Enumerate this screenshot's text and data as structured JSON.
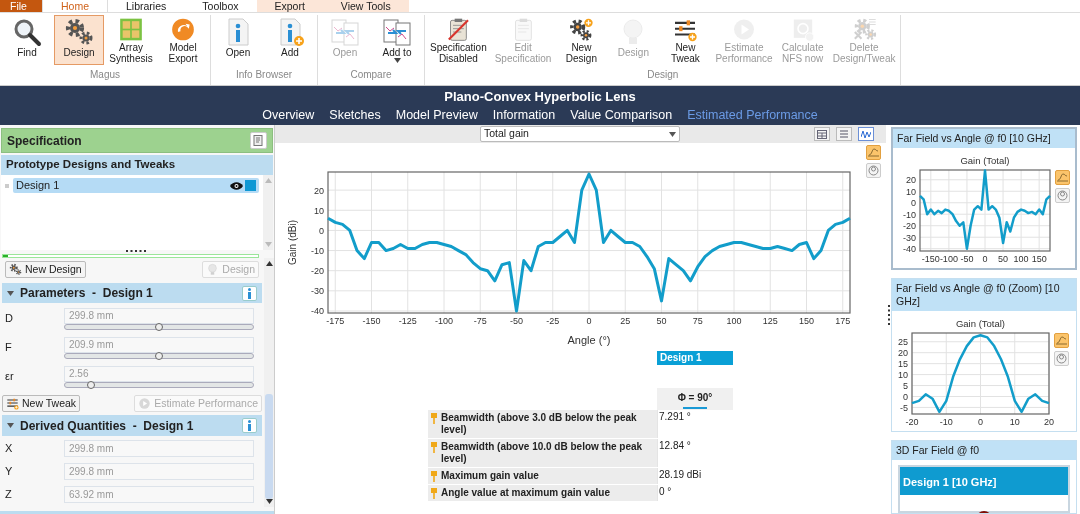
{
  "ribbon_tabs": [
    {
      "label": "File",
      "kind": "file",
      "selected": false
    },
    {
      "label": "Home",
      "kind": "tab",
      "selected": true
    },
    {
      "label": "Libraries",
      "kind": "tab",
      "selected": false
    },
    {
      "label": "Toolbox",
      "kind": "tab",
      "selected": false
    },
    {
      "label": "Export",
      "kind": "context",
      "selected": false
    },
    {
      "label": "View Tools",
      "kind": "context",
      "selected": false
    }
  ],
  "ribbon_groups": [
    {
      "label": "Magus",
      "buttons": [
        {
          "label": "Find",
          "kind": "search",
          "selected": false,
          "disabled": false
        },
        {
          "label": "Design",
          "kind": "gears",
          "selected": true,
          "disabled": false
        },
        {
          "label": "Array Synthesis",
          "kind": "grid",
          "selected": false,
          "disabled": false
        },
        {
          "label": "Model Export",
          "kind": "export",
          "selected": false,
          "disabled": false
        }
      ]
    },
    {
      "label": "Info Browser",
      "buttons": [
        {
          "label": "Open",
          "kind": "info",
          "selected": false,
          "disabled": false
        },
        {
          "label": "Add",
          "kind": "infoadd",
          "selected": false,
          "disabled": false
        }
      ]
    },
    {
      "label": "Compare",
      "buttons": [
        {
          "label": "Open",
          "kind": "compare",
          "selected": false,
          "disabled": true
        },
        {
          "label": "Add to",
          "kind": "compareadd",
          "selected": false,
          "disabled": false,
          "dropdown": true
        }
      ]
    },
    {
      "label": "Design",
      "buttons": [
        {
          "label": "Specification Disabled",
          "kind": "specoff",
          "selected": false,
          "disabled": false
        },
        {
          "label": "Edit Specification",
          "kind": "clipboard",
          "selected": false,
          "disabled": true
        },
        {
          "label": "New Design",
          "kind": "gearsadd",
          "selected": false,
          "disabled": false
        },
        {
          "label": "Design",
          "kind": "bulb",
          "selected": false,
          "disabled": true
        },
        {
          "label": "New Tweak",
          "kind": "tweak",
          "selected": false,
          "disabled": false
        },
        {
          "label": "Estimate Performance",
          "kind": "play",
          "selected": false,
          "disabled": true
        },
        {
          "label": "Calculate NFS now",
          "kind": "nfs",
          "selected": false,
          "disabled": true
        },
        {
          "label": "Delete Design/Tweak",
          "kind": "gearsx",
          "selected": false,
          "disabled": true
        }
      ]
    }
  ],
  "document": {
    "title": "Plano-Convex Hyperbolic Lens",
    "nav": [
      {
        "label": "Overview",
        "selected": false
      },
      {
        "label": "Sketches",
        "selected": false
      },
      {
        "label": "Model Preview",
        "selected": false
      },
      {
        "label": "Information",
        "selected": false
      },
      {
        "label": "Value Comparison",
        "selected": false
      },
      {
        "label": "Estimated Performance",
        "selected": true
      }
    ]
  },
  "left_panel": {
    "title": "Specification",
    "designs_header": "Prototype Designs and Tweaks",
    "designs": [
      {
        "label": "Design 1",
        "selected": true,
        "visible": true,
        "color": "#0e98d4"
      }
    ],
    "progress": {
      "level": 0.02
    },
    "top_buttons": [
      {
        "label": "New Design",
        "kind": "gears",
        "disabled": false
      },
      {
        "label": "Design",
        "kind": "bulb",
        "disabled": true
      }
    ],
    "parameters": {
      "title": "Parameters  -  Design 1",
      "rows": [
        {
          "name": "D",
          "value": "299.8 mm",
          "level": 0.5
        },
        {
          "name": "F",
          "value": "209.9 mm",
          "level": 0.5
        },
        {
          "name": "εr",
          "value": "2.56",
          "level": 0.14
        }
      ]
    },
    "bottom_buttons": [
      {
        "label": "New Tweak",
        "kind": "tweak",
        "disabled": false
      },
      {
        "label": "Estimate Performance",
        "kind": "play",
        "disabled": true
      }
    ],
    "derived": {
      "title": "Derived Quantities  -  Design 1",
      "rows": [
        {
          "name": "X",
          "value": "299.8 mm"
        },
        {
          "name": "Y",
          "value": "299.8 mm"
        },
        {
          "name": "Z",
          "value": "63.92 mm"
        }
      ]
    }
  },
  "center": {
    "dropdown": "Total gain",
    "view_buttons": [
      {
        "selected": true
      },
      {
        "selected": false
      }
    ],
    "chart_data": {
      "type": "line",
      "grid": true,
      "xlabel": "Angle (°)",
      "ylabel": "Gain (dBi)",
      "xlim": [
        -180,
        180
      ],
      "ylim": [
        -41,
        29
      ],
      "xticks": [
        -175,
        -150,
        -125,
        -100,
        -75,
        -50,
        -25,
        0,
        25,
        50,
        75,
        100,
        125,
        150,
        175
      ],
      "yticks": [
        -40,
        -30,
        -20,
        -10,
        0,
        10,
        20
      ],
      "x": [
        -180,
        -175,
        -170,
        -165,
        -160,
        -155,
        -150,
        -145,
        -140,
        -135,
        -130,
        -125,
        -120,
        -115,
        -110,
        -105,
        -100,
        -95,
        -90,
        -85,
        -80,
        -75,
        -70,
        -65,
        -60,
        -55,
        -50,
        -45,
        -40,
        -35,
        -30,
        -25,
        -20,
        -15,
        -10,
        -5,
        0,
        5,
        10,
        15,
        20,
        25,
        30,
        35,
        40,
        45,
        50,
        55,
        60,
        65,
        70,
        75,
        80,
        85,
        90,
        95,
        100,
        105,
        110,
        115,
        120,
        125,
        130,
        135,
        140,
        145,
        150,
        155,
        160,
        165,
        170,
        175,
        180
      ],
      "series": [
        {
          "color": "#129dca",
          "values": [
            6,
            4,
            3,
            0,
            -10,
            -14,
            -6,
            -6,
            -10,
            -9,
            -7,
            -9,
            -9,
            -7,
            -6,
            -6,
            -7,
            -8,
            -10,
            -12,
            -16,
            -19,
            -20,
            -25,
            -17,
            -16,
            -40,
            -15,
            -20,
            -8,
            -6,
            -6,
            -3,
            0,
            -6,
            20,
            28,
            20,
            -6,
            0,
            -3,
            -6,
            -6,
            -8,
            -13,
            -19,
            -35,
            -14,
            -17,
            -20,
            -25,
            -18,
            -13,
            -10,
            -8,
            -7,
            -6,
            -6,
            -7,
            -8,
            -9,
            -9,
            -8,
            -9,
            -10,
            -7,
            -6,
            -14,
            -10,
            0,
            3,
            4,
            6
          ]
        }
      ]
    },
    "results": {
      "design_label": "Design 1",
      "column": "Φ = 90°",
      "rows": [
        {
          "label": "Beamwidth (above 3.0 dB below the peak level)",
          "value": "7.291 °"
        },
        {
          "label": "Beamwidth (above 10.0 dB below the peak level)",
          "value": "12.84 °"
        },
        {
          "label": "Maximum gain value",
          "value": "28.19 dBi"
        },
        {
          "label": "Angle value at maximum gain value",
          "value": "0 °"
        }
      ]
    }
  },
  "side_panels": [
    {
      "title": "Far Field vs Angle @ f0 [10 GHz]",
      "kind": "chart",
      "selected": true,
      "view_buttons": [
        {
          "selected": true
        },
        {
          "selected": false
        }
      ],
      "chart_data": {
        "type": "line",
        "grid": true,
        "title": "Gain (Total)",
        "xlim": [
          -180,
          180
        ],
        "ylim": [
          -42,
          28.5
        ],
        "xticks": [
          -150,
          -100,
          -50,
          0,
          50,
          100,
          150
        ],
        "yticks": [
          -40,
          -30,
          -20,
          -10,
          0,
          10,
          20
        ],
        "x": [
          -180,
          -170,
          -160,
          -150,
          -140,
          -130,
          -120,
          -110,
          -100,
          -90,
          -80,
          -70,
          -60,
          -50,
          -40,
          -30,
          -20,
          -10,
          0,
          10,
          20,
          30,
          40,
          50,
          60,
          70,
          80,
          90,
          100,
          110,
          120,
          130,
          140,
          150,
          160,
          170,
          180
        ],
        "series": [
          {
            "color": "#129dca",
            "values": [
              6,
              3,
              -10,
              -6,
              -10,
              -7,
              -9,
              -6,
              -7,
              -10,
              -16,
              -20,
              -17,
              -40,
              -20,
              -6,
              -3,
              -6,
              28,
              -6,
              -3,
              -6,
              -13,
              -35,
              -17,
              -25,
              -13,
              -8,
              -6,
              -7,
              -9,
              -8,
              -10,
              -6,
              -10,
              3,
              6
            ]
          }
        ]
      }
    },
    {
      "title": "Far Field vs Angle @ f0 (Zoom) [10 GHz]",
      "kind": "chart",
      "selected": false,
      "view_buttons": [
        {
          "selected": true
        },
        {
          "selected": false
        }
      ],
      "chart_data": {
        "type": "line",
        "grid": true,
        "title": "Gain (Total)",
        "xlim": [
          -20,
          20
        ],
        "ylim": [
          -8,
          29
        ],
        "xticks": [
          -20,
          -10,
          0,
          10,
          20
        ],
        "yticks": [
          -5,
          0,
          5,
          10,
          15,
          20,
          25
        ],
        "x": [
          -20,
          -18,
          -16,
          -14,
          -12,
          -10,
          -8,
          -6,
          -4,
          -2,
          0,
          2,
          4,
          6,
          8,
          10,
          12,
          14,
          16,
          18,
          20
        ],
        "series": [
          {
            "color": "#129dca",
            "values": [
              -3,
              -2,
              1,
              -1,
              -7,
              -2,
              9,
              17,
              23,
              27,
              28,
              27,
              23,
              17,
              9,
              -2,
              -7,
              -1,
              1,
              -2,
              -3
            ]
          }
        ]
      }
    },
    {
      "title": "3D Far Field @ f0",
      "kind": "viewer",
      "selected": false,
      "view_title": "Design 1 [10 GHz]"
    }
  ]
}
